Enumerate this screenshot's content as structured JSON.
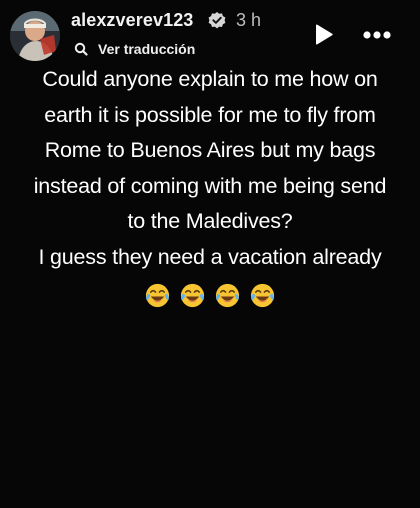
{
  "header": {
    "username": "alexzverev123",
    "time": "3 h",
    "translate_label": "Ver traducción"
  },
  "icons": {
    "verified": "verified-badge-icon",
    "translate": "translate-icon",
    "play": "play-icon",
    "more": "more-options-icon",
    "emoji": "face-with-tears-of-joy-icon"
  },
  "caption": {
    "lines": [
      "Could anyone explain to me how on",
      "earth it is possible for me to fly from",
      "Rome to Buenos Aires but my bags",
      "instead of coming with me being send",
      "to the Maledives?",
      "I guess they need a vacation already"
    ],
    "emoji_count": 4
  },
  "colors": {
    "background": "#060606",
    "text": "#ffffff",
    "secondary_text": "#bdbdbd",
    "emoji_face": "#f7c531"
  }
}
